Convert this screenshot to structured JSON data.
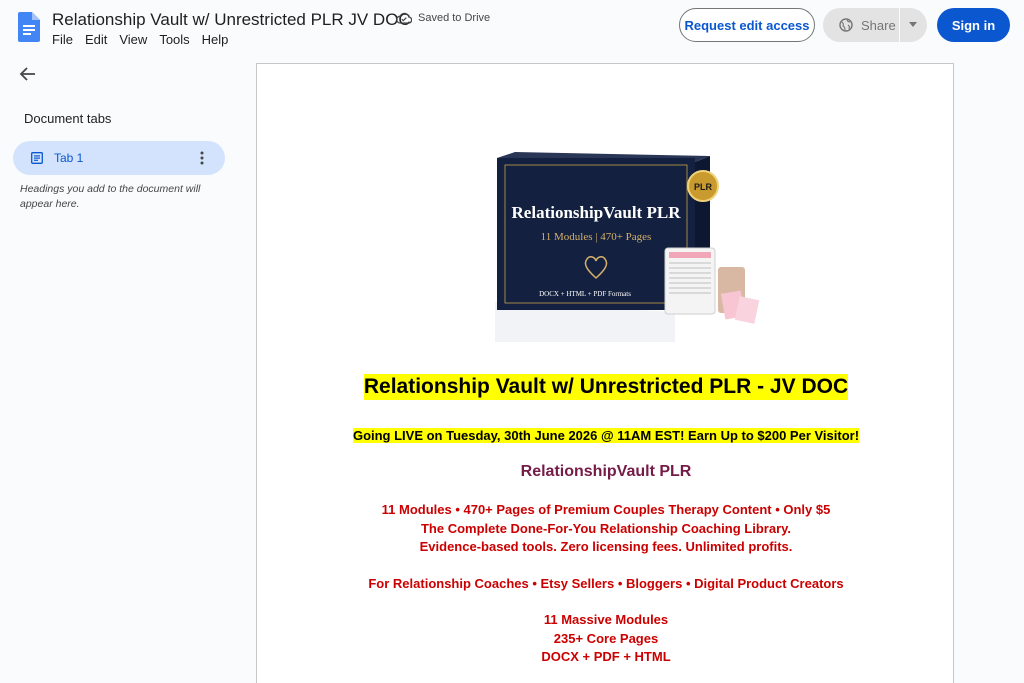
{
  "header": {
    "title": "Relationship Vault w/ Unrestricted PLR JV DOC",
    "saved_status": "Saved to Drive",
    "menu": [
      "File",
      "Edit",
      "View",
      "Tools",
      "Help"
    ],
    "request_edit_label": "Request edit access",
    "share_label": "Share",
    "signin_label": "Sign in"
  },
  "sidebar": {
    "tabs_heading": "Document tabs",
    "tabs": [
      {
        "label": "Tab 1"
      }
    ],
    "hint": "Headings you add to the document will appear here."
  },
  "product_box": {
    "title": "RelationshipVault PLR",
    "subtitle": "11 Modules | 470+ Pages",
    "formats": "DOCX + HTML + PDF Formats",
    "seal": "PLR"
  },
  "document": {
    "heading": "Relationship Vault w/ Unrestricted PLR - JV DOC",
    "golive": "Going LIVE on Tuesday, 30th June 2026 @ 11AM EST!  Earn Up to $200 Per Visitor!",
    "brand": "RelationshipVault PLR",
    "block1": [
      "11 Modules • 470+ Pages of Premium Couples Therapy Content • Only $5",
      "The Complete Done-For-You Relationship Coaching Library.",
      "Evidence-based tools. Zero licensing fees. Unlimited profits."
    ],
    "audience": "For Relationship Coaches • Etsy Sellers • Bloggers • Digital Product Creators",
    "block3": [
      "11 Massive Modules",
      "235+ Core Pages",
      "DOCX + PDF + HTML"
    ]
  },
  "colors": {
    "accent": "#0b57d0",
    "highlight": "#ffff00",
    "red_text": "#cc0000",
    "brand_text": "#741b47"
  }
}
